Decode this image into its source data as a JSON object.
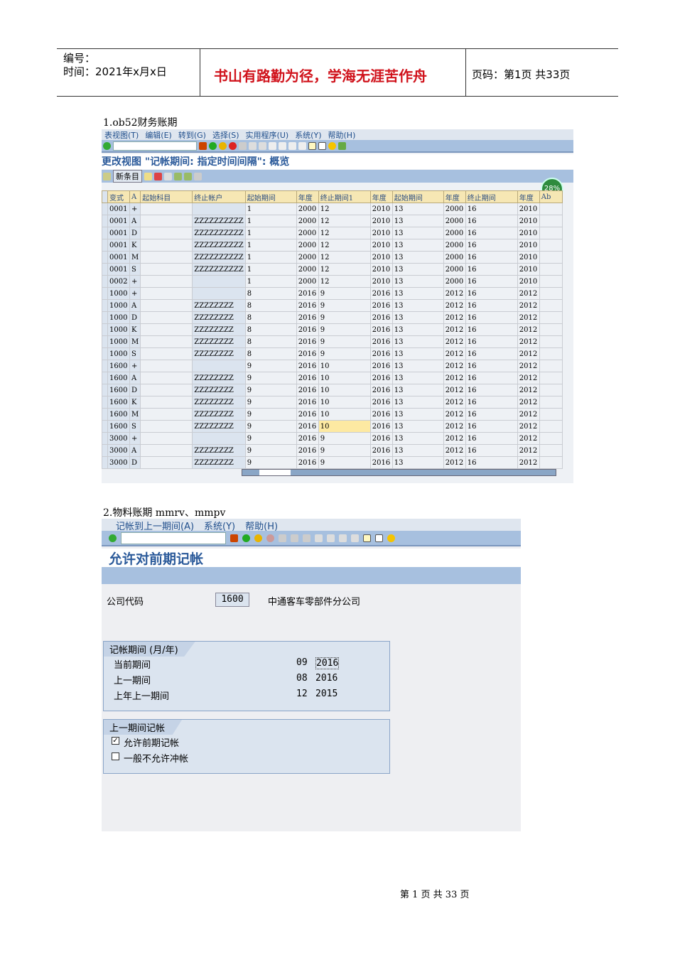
{
  "header": {
    "number_label": "编号：",
    "time_label": "时间：2021年x月x日",
    "motto": "书山有路勤为径，学海无涯苦作舟",
    "page_label": "页码：第1页  共33页"
  },
  "section1": {
    "caption": "1.ob52财务账期",
    "menu": [
      "表视图(T)",
      "编辑(E)",
      "转到(G)",
      "选择(S)",
      "实用程序(U)",
      "系统(Y)",
      "帮助(H)"
    ],
    "title": "更改视图 \"记帐期间: 指定时间间隔\": 概览",
    "new_entry_button": "新条目",
    "badge": "28%",
    "columns": [
      "变式",
      "A",
      "起始科目",
      "终止帐户",
      "起始期间",
      "年度",
      "终止期间1",
      "年度",
      "起始期间",
      "年度",
      "终止期间",
      "年度",
      "Ab"
    ],
    "rows": [
      [
        "0001",
        "+",
        "",
        "",
        "1",
        "2000",
        "12",
        "2010",
        "13",
        "2000",
        "16",
        "2010",
        ""
      ],
      [
        "0001",
        "A",
        "",
        "ZZZZZZZZZZ",
        "1",
        "2000",
        "12",
        "2010",
        "13",
        "2000",
        "16",
        "2010",
        ""
      ],
      [
        "0001",
        "D",
        "",
        "ZZZZZZZZZZ",
        "1",
        "2000",
        "12",
        "2010",
        "13",
        "2000",
        "16",
        "2010",
        ""
      ],
      [
        "0001",
        "K",
        "",
        "ZZZZZZZZZZ",
        "1",
        "2000",
        "12",
        "2010",
        "13",
        "2000",
        "16",
        "2010",
        ""
      ],
      [
        "0001",
        "M",
        "",
        "ZZZZZZZZZZ",
        "1",
        "2000",
        "12",
        "2010",
        "13",
        "2000",
        "16",
        "2010",
        ""
      ],
      [
        "0001",
        "S",
        "",
        "ZZZZZZZZZZ",
        "1",
        "2000",
        "12",
        "2010",
        "13",
        "2000",
        "16",
        "2010",
        ""
      ],
      [
        "0002",
        "+",
        "",
        "",
        "1",
        "2000",
        "12",
        "2010",
        "13",
        "2000",
        "16",
        "2010",
        ""
      ],
      [
        "1000",
        "+",
        "",
        "",
        "8",
        "2016",
        "9",
        "2016",
        "13",
        "2012",
        "16",
        "2012",
        ""
      ],
      [
        "1000",
        "A",
        "",
        "ZZZZZZZZ",
        "8",
        "2016",
        "9",
        "2016",
        "13",
        "2012",
        "16",
        "2012",
        ""
      ],
      [
        "1000",
        "D",
        "",
        "ZZZZZZZZ",
        "8",
        "2016",
        "9",
        "2016",
        "13",
        "2012",
        "16",
        "2012",
        ""
      ],
      [
        "1000",
        "K",
        "",
        "ZZZZZZZZ",
        "8",
        "2016",
        "9",
        "2016",
        "13",
        "2012",
        "16",
        "2012",
        ""
      ],
      [
        "1000",
        "M",
        "",
        "ZZZZZZZZ",
        "8",
        "2016",
        "9",
        "2016",
        "13",
        "2012",
        "16",
        "2012",
        ""
      ],
      [
        "1000",
        "S",
        "",
        "ZZZZZZZZ",
        "8",
        "2016",
        "9",
        "2016",
        "13",
        "2012",
        "16",
        "2012",
        ""
      ],
      [
        "1600",
        "+",
        "",
        "",
        "9",
        "2016",
        "10",
        "2016",
        "13",
        "2012",
        "16",
        "2012",
        ""
      ],
      [
        "1600",
        "A",
        "",
        "ZZZZZZZZ",
        "9",
        "2016",
        "10",
        "2016",
        "13",
        "2012",
        "16",
        "2012",
        ""
      ],
      [
        "1600",
        "D",
        "",
        "ZZZZZZZZ",
        "9",
        "2016",
        "10",
        "2016",
        "13",
        "2012",
        "16",
        "2012",
        ""
      ],
      [
        "1600",
        "K",
        "",
        "ZZZZZZZZ",
        "9",
        "2016",
        "10",
        "2016",
        "13",
        "2012",
        "16",
        "2012",
        ""
      ],
      [
        "1600",
        "M",
        "",
        "ZZZZZZZZ",
        "9",
        "2016",
        "10",
        "2016",
        "13",
        "2012",
        "16",
        "2012",
        ""
      ],
      [
        "1600",
        "S",
        "",
        "ZZZZZZZZ",
        "9",
        "2016",
        "10",
        "2016",
        "13",
        "2012",
        "16",
        "2012",
        ""
      ],
      [
        "3000",
        "+",
        "",
        "",
        "9",
        "2016",
        "9",
        "2016",
        "13",
        "2012",
        "16",
        "2012",
        ""
      ],
      [
        "3000",
        "A",
        "",
        "ZZZZZZZZ",
        "9",
        "2016",
        "9",
        "2016",
        "13",
        "2012",
        "16",
        "2012",
        ""
      ],
      [
        "3000",
        "D",
        "",
        "ZZZZZZZZ",
        "9",
        "2016",
        "9",
        "2016",
        "13",
        "2012",
        "16",
        "2012",
        ""
      ]
    ]
  },
  "section2": {
    "caption": "2.物料账期 mmrv、mmpv",
    "menu": [
      "记帐到上一期间(A)",
      "系统(Y)",
      "帮助(H)"
    ],
    "title": "允许对前期记帐",
    "company_code_label": "公司代码",
    "company_code": "1600",
    "company_name": "中通客车零部件分公司",
    "period_group": {
      "title": "记帐期间 (月/年)",
      "rows": [
        {
          "label": "当前期间",
          "month": "09",
          "year": "2016"
        },
        {
          "label": "上一期间",
          "month": "08",
          "year": "2016"
        },
        {
          "label": "上年上一期间",
          "month": "12",
          "year": "2015"
        }
      ]
    },
    "posting_group": {
      "title": "上一期间记帐",
      "options": [
        {
          "label": "允许前期记帐",
          "checked": true
        },
        {
          "label": "一般不允许冲帐",
          "checked": false
        }
      ]
    }
  },
  "footer": "第 1 页 共 33 页"
}
